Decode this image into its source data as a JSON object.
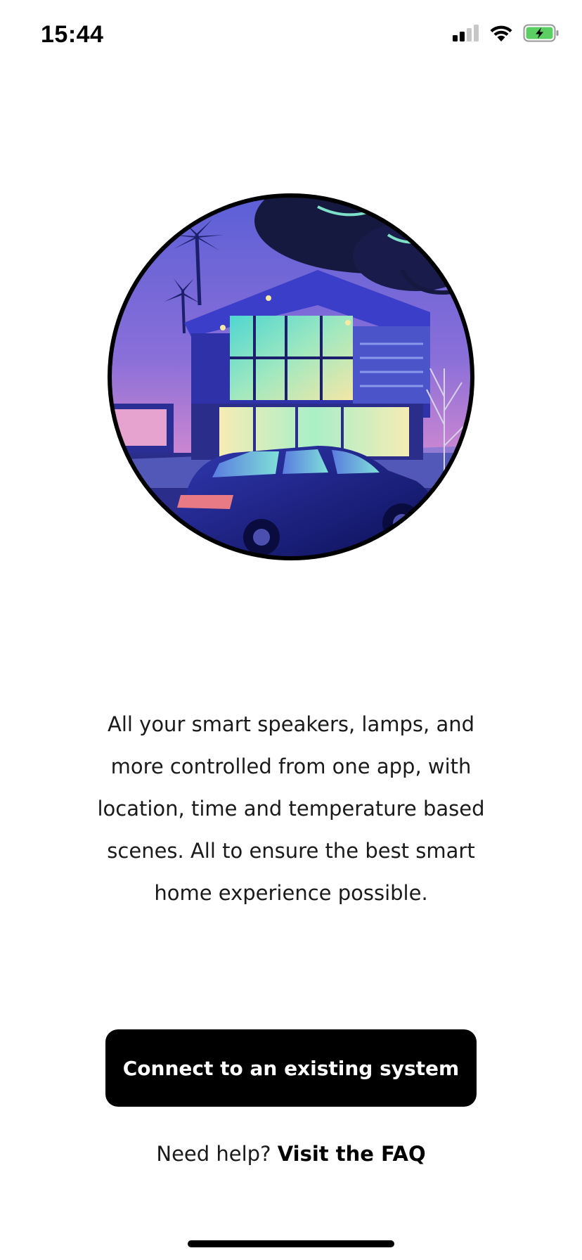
{
  "status_bar": {
    "time": "15:44",
    "icons": [
      "cellular-signal-icon",
      "wifi-icon",
      "battery-charging-icon"
    ]
  },
  "hero": {
    "illustration": "smart-home-house-car-illustration"
  },
  "main": {
    "description": "All your smart speakers, lamps, and more controlled from one app, with location, time and temperature based scenes. All to ensure the best smart home experience possible.",
    "primary_button_label": "Connect to an existing system",
    "help_prefix": "Need help?",
    "help_link_label": "Visit the FAQ"
  },
  "colors": {
    "button_bg": "#000000",
    "button_text": "#ffffff",
    "battery_fill": "#5ccf63"
  }
}
